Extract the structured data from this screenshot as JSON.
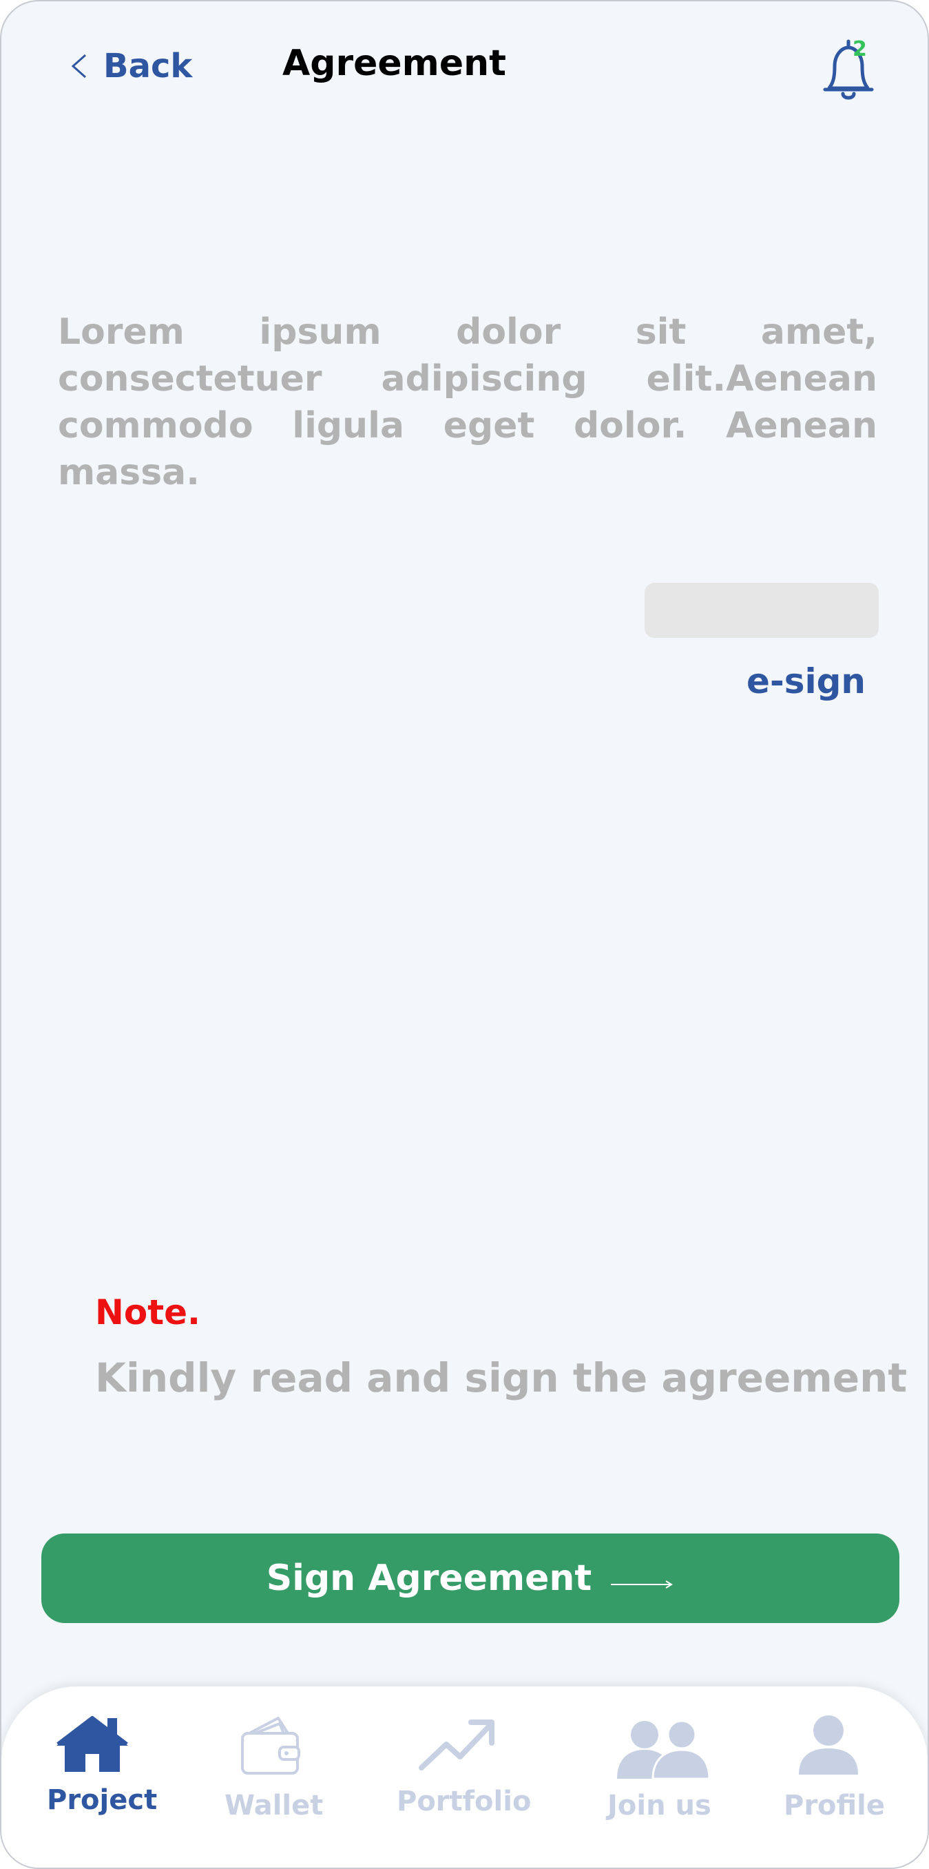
{
  "header": {
    "back_label": "Back",
    "title": "Agreement",
    "notification_count": "2"
  },
  "content": {
    "body_text": "Lorem ipsum dolor sit amet, consectetuer adipiscing elit.Aenean commodo ligula eget dolor. Aenean massa.",
    "esign_label": "e-sign"
  },
  "note": {
    "title": "Note.",
    "text": "Kindly read and sign the agreement"
  },
  "primary_button": {
    "label": "Sign Agreement"
  },
  "bottom_nav": {
    "items": [
      {
        "label": "Project",
        "icon": "home-icon",
        "active": true
      },
      {
        "label": "Wallet",
        "icon": "wallet-icon",
        "active": false
      },
      {
        "label": "Portfolio",
        "icon": "trending-up-icon",
        "active": false
      },
      {
        "label": "Join us",
        "icon": "users-icon",
        "active": false
      },
      {
        "label": "Profile",
        "icon": "user-icon",
        "active": false
      }
    ]
  },
  "colors": {
    "brand_blue": "#2f56a0",
    "accent_green": "#359b67",
    "note_red": "#ee1111",
    "muted_text": "#b3b3b3",
    "inactive_nav": "#c8d1e3",
    "background": "#f3f6fb"
  }
}
